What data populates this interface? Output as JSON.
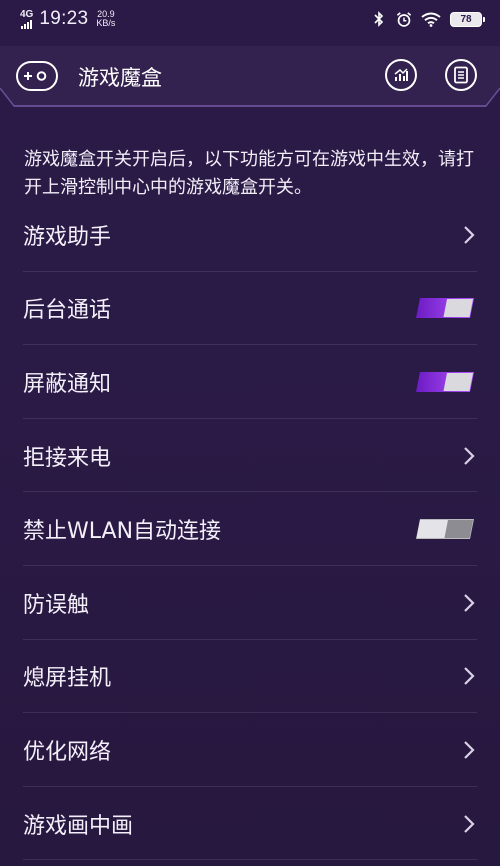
{
  "status_bar": {
    "network": "4G",
    "time": "19:23",
    "speed_value": "20.9",
    "speed_unit": "KB/s",
    "battery": "78",
    "icons": [
      "bluetooth-icon",
      "alarm-icon",
      "wifi-icon",
      "battery-icon"
    ]
  },
  "header": {
    "title": "游戏魔盒",
    "logo_icon": "game-controller-icon",
    "actions": [
      {
        "name": "stats-button",
        "icon": "chart-icon"
      },
      {
        "name": "record-button",
        "icon": "document-icon"
      }
    ]
  },
  "notice": "游戏魔盒开关开启后，以下功能方可在游戏中生效，请打开上滑控制中心中的游戏魔盒开关。",
  "colors": {
    "background": "#2a1a46",
    "toggle_on": "#8a2be2",
    "toggle_off": "#9a9a9a"
  },
  "items": [
    {
      "label": "游戏助手",
      "control": "chevron"
    },
    {
      "label": "后台通话",
      "control": "toggle",
      "enabled": true
    },
    {
      "label": "屏蔽通知",
      "control": "toggle",
      "enabled": true
    },
    {
      "label": "拒接来电",
      "control": "chevron"
    },
    {
      "label": "禁止WLAN自动连接",
      "control": "toggle",
      "enabled": false
    },
    {
      "label": "防误触",
      "control": "chevron"
    },
    {
      "label": "熄屏挂机",
      "control": "chevron"
    },
    {
      "label": "优化网络",
      "control": "chevron"
    },
    {
      "label": "游戏画中画",
      "control": "chevron"
    }
  ]
}
